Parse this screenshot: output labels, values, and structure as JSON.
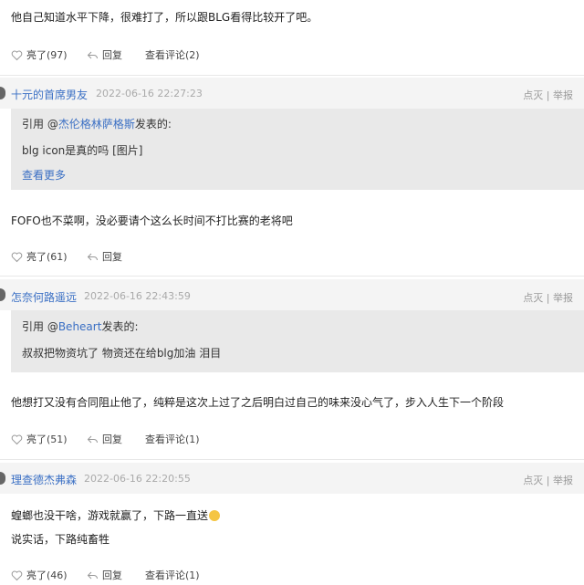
{
  "comments": [
    {
      "user": "",
      "time": "",
      "report": "",
      "quote": null,
      "body": [
        "他自己知道水平下降，很难打了，所以跟BLG看得比较开了吧。"
      ],
      "like_label": "亮了(97)",
      "reply_label": "回复",
      "view_replies_label": "查看评论(2)"
    },
    {
      "user": "十元的首席男友",
      "time": "2022-06-16 22:27:23",
      "report": "点灭 | 举报",
      "quote": {
        "prefix": "引用 @",
        "author": "杰伦格林萨格斯",
        "suffix": "发表的:",
        "text": "blg icon是真的吗 [图片]",
        "more": "查看更多"
      },
      "body": [
        "FOFO也不菜啊，没必要请个这么长时间不打比赛的老将吧"
      ],
      "like_label": "亮了(61)",
      "reply_label": "回复",
      "view_replies_label": ""
    },
    {
      "user": "怎奈何路遥远",
      "time": "2022-06-16 22:43:59",
      "report": "点灭 | 举报",
      "quote": {
        "prefix": "引用 @",
        "author": "Beheart",
        "suffix": "发表的:",
        "text": "叔叔把物资坑了 物资还在给blg加油 泪目",
        "more": ""
      },
      "body": [
        "他想打又没有合同阻止他了，纯粹是这次上过了之后明白过自己的味来没心气了，步入人生下一个阶段"
      ],
      "like_label": "亮了(51)",
      "reply_label": "回复",
      "view_replies_label": "查看评论(1)"
    },
    {
      "user": "理查德杰弗森",
      "time": "2022-06-16 22:20:55",
      "report": "点灭 | 举报",
      "quote": null,
      "body": [
        "蝗螂也没干啥，游戏就赢了，下路一直送",
        "说实话，下路纯畜牲"
      ],
      "like_label": "亮了(46)",
      "reply_label": "回复",
      "view_replies_label": "查看评论(1)"
    }
  ],
  "icons": {
    "like": "heart-icon",
    "reply": "reply-arrow-icon",
    "emoji": "grinning-face-emoji"
  },
  "colors": {
    "link": "#3a6fc4",
    "header_bg": "#f4f4f4",
    "quote_bg": "#e9e9e9"
  }
}
